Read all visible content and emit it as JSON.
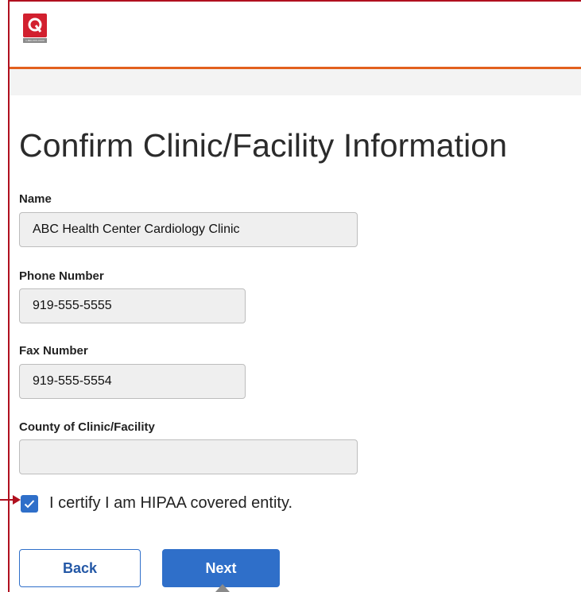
{
  "header": {
    "logo_letter": "Q",
    "logo_tagline": "1-800-XXX-XXXX"
  },
  "page_title": "Confirm Clinic/Facility Information",
  "form": {
    "name": {
      "label": "Name",
      "value": "ABC Health Center Cardiology Clinic"
    },
    "phone": {
      "label": "Phone Number",
      "value": "919-555-5555"
    },
    "fax": {
      "label": "Fax Number",
      "value": "919-555-5554"
    },
    "county": {
      "label": "County of Clinic/Facility",
      "value": ""
    },
    "hipaa": {
      "label": "I certify I am HIPAA covered entity.",
      "checked": true
    }
  },
  "buttons": {
    "back": "Back",
    "next": "Next"
  },
  "colors": {
    "brand_red": "#d2202f",
    "accent_orange": "#e2601e",
    "primary_blue": "#2f6fc9",
    "annotation_red": "#b0101f",
    "annotation_gray": "#8a8a8a"
  }
}
